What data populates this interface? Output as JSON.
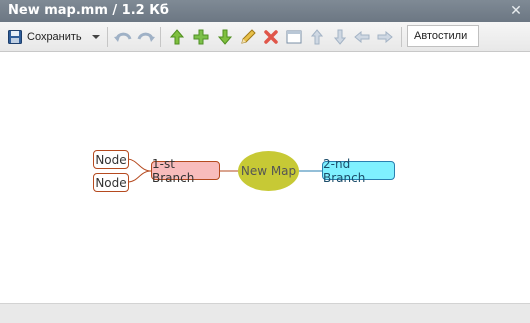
{
  "window": {
    "title": "New map.mm / 1.2 Кб",
    "close_icon": "close-icon"
  },
  "toolbar": {
    "save_label": "Сохранить",
    "autostyles_label": "Автостили",
    "icons": [
      "save-disk-icon",
      "dropdown-arrow-icon",
      "undo-icon",
      "redo-icon",
      "move-up-icon",
      "add-icon",
      "move-down-icon",
      "edit-pencil-icon",
      "delete-icon",
      "frame-icon",
      "arrow-up-icon",
      "arrow-down-icon",
      "arrow-left-icon",
      "arrow-right-icon"
    ]
  },
  "mindmap": {
    "center": "New Map",
    "branches": [
      {
        "label": "1-st Branch",
        "children": [
          "Node",
          "Node"
        ]
      },
      {
        "label": "2-nd Branch",
        "children": []
      }
    ]
  },
  "colors": {
    "titlebar": "#76818c",
    "center_fill": "#c7c935",
    "branch1_fill": "#f8bcbc",
    "branch1_border": "#b54a1f",
    "branch2_fill": "#7ff0ff",
    "branch2_border": "#2a7fb0"
  }
}
